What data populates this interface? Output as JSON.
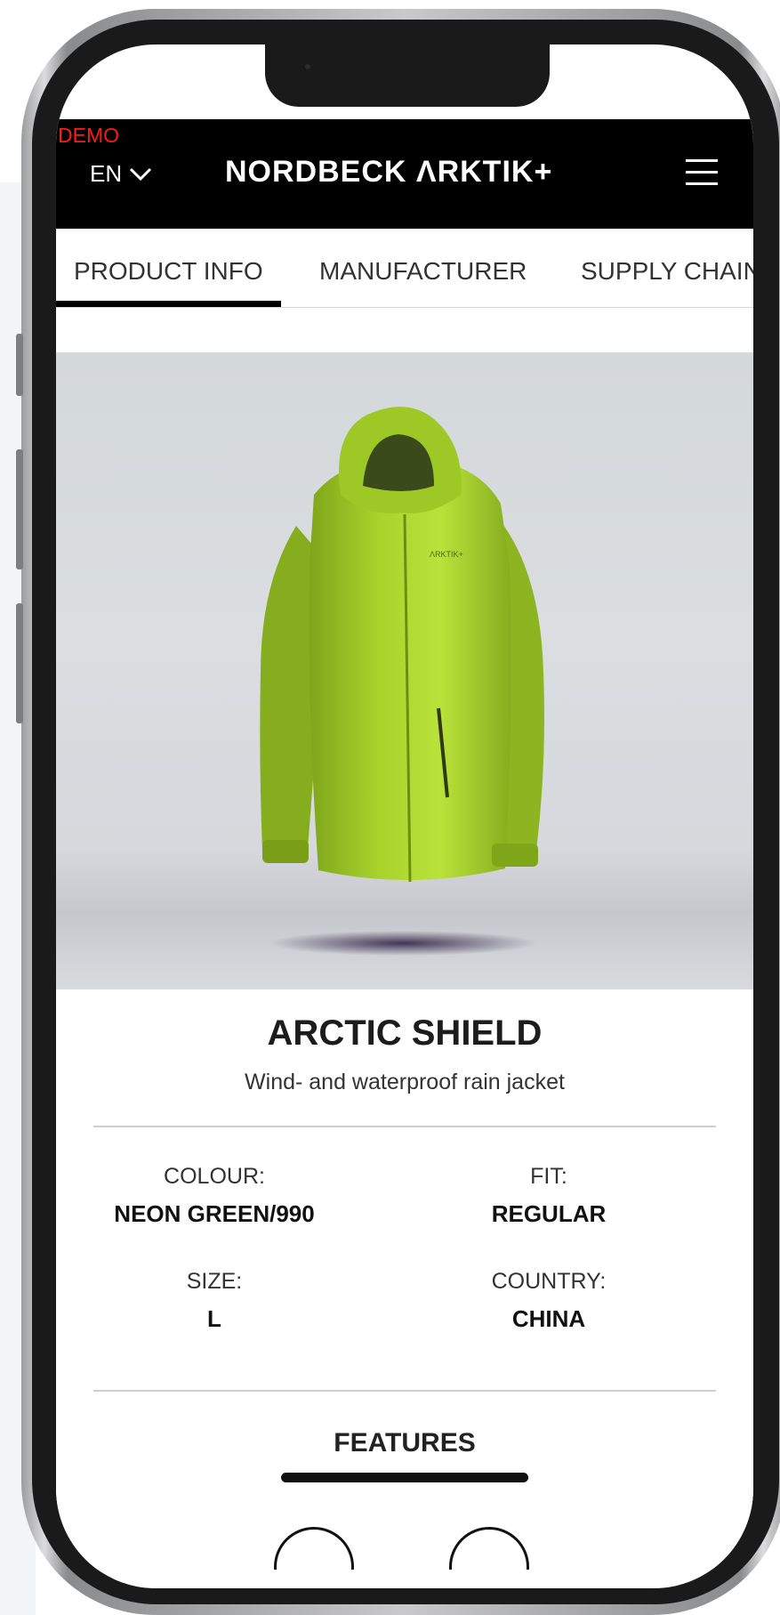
{
  "header": {
    "demo_label": "DEMO",
    "language": "EN",
    "brand": "NORDBECK ΛRKTIK+"
  },
  "tabs": [
    {
      "label": "PRODUCT INFO",
      "active": true
    },
    {
      "label": "MANUFACTURER",
      "active": false
    },
    {
      "label": "SUPPLY CHAIN",
      "active": false
    }
  ],
  "product": {
    "image": "neon-green-rain-jacket",
    "name": "ARCTIC SHIELD",
    "description": "Wind- and waterproof rain jacket",
    "specs": {
      "colour": {
        "label": "COLOUR:",
        "value": "NEON GREEN/990"
      },
      "fit": {
        "label": "FIT:",
        "value": "REGULAR"
      },
      "size": {
        "label": "SIZE:",
        "value": "L"
      },
      "country": {
        "label": "COUNTRY:",
        "value": "CHINA"
      }
    }
  },
  "features": {
    "heading": "FEATURES"
  },
  "colors": {
    "header_bg": "#000000",
    "demo_text": "#ff1a1a",
    "jacket": "#a7d62a"
  }
}
